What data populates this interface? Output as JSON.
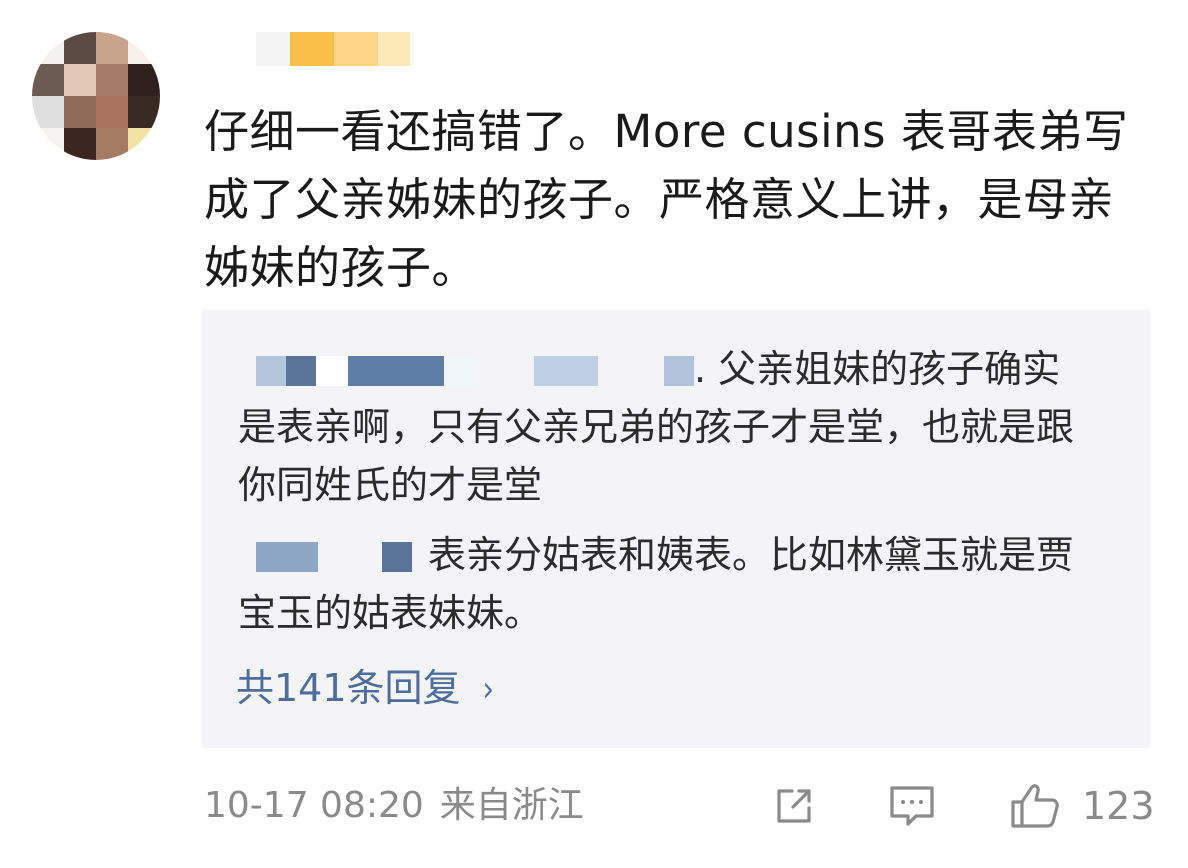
{
  "comment": {
    "text": "仔细一看还搞错了。More cusins 表哥表弟写成了父亲姊妹的孩子。严格意义上讲，是母亲姊妹的孩子。",
    "date": "10-17 08:20",
    "location": "来自浙江",
    "like_count": "123"
  },
  "replies": [
    {
      "text": ". 父亲姐妹的孩子确实是表亲啊，只有父亲兄弟的孩子才是堂，也就是跟你同姓氏的才是堂"
    },
    {
      "text": "表亲分姑表和姨表。比如林黛玉就是贾宝玉的姑表妹妹。"
    }
  ],
  "replies_link": {
    "label": "共141条回复",
    "chevron": "›"
  },
  "icons": {
    "share": "share-icon",
    "comment": "comment-icon",
    "like": "thumbs-up-icon",
    "chevron": "chevron-right-icon"
  },
  "colors": {
    "text": "#1a1a1a",
    "link": "#4f6d99",
    "muted": "#8a8a8a",
    "reply_bg": "#f4f4f6"
  }
}
